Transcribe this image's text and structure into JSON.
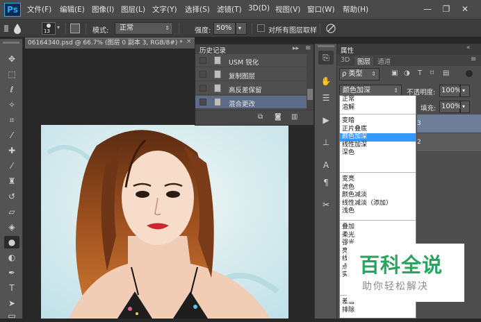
{
  "app": {
    "logo": "Ps"
  },
  "menu": {
    "items": [
      "文件(F)",
      "编辑(E)",
      "图像(I)",
      "图层(L)",
      "文字(Y)",
      "选择(S)",
      "滤镜(T)",
      "3D(D)",
      "视图(V)",
      "窗口(W)",
      "帮助(H)"
    ]
  },
  "window_controls": {
    "minimize": "—",
    "restore": "❐",
    "close": "✕"
  },
  "options_bar": {
    "brush_size": "13",
    "mode_label": "模式:",
    "mode_value": "正常",
    "strength_label": "强度:",
    "strength_value": "50%",
    "sample_all_label": "对所有图层取样"
  },
  "document": {
    "tab_title": "06164340.psd @ 66.7% (图层 0 副本 3, RGB/8#) *",
    "close_icon": "×"
  },
  "history": {
    "title": "历史记录",
    "items": [
      {
        "label": "USM 锐化"
      },
      {
        "label": "复制图层"
      },
      {
        "label": "高反差保留"
      },
      {
        "label": "混合更改"
      }
    ],
    "selected_index": 3
  },
  "layers_panel": {
    "properties_tab": "属性",
    "tabs": [
      "3D",
      "图层",
      "通道"
    ],
    "active_tab": "图层",
    "filter_kind": "ρ 类型",
    "blend_mode": "颜色加深",
    "opacity_label": "不透明度:",
    "opacity_value": "100%",
    "fill_label": "填充:",
    "fill_value": "100%",
    "layer_rows": [
      "3",
      "2"
    ]
  },
  "blend_dropdown": {
    "groups": [
      [
        "正常",
        "溶解"
      ],
      [
        "变暗",
        "正片叠底",
        "颜色加深",
        "线性加深",
        "深色"
      ],
      [
        "变亮",
        "滤色",
        "颜色减淡",
        "线性减淡（添加）",
        "浅色"
      ],
      [
        "叠加",
        "柔光",
        "强光",
        "亮光",
        "线性光",
        "点光",
        "实色混合"
      ],
      [
        "差值",
        "排除"
      ]
    ],
    "selected": "颜色加深"
  },
  "watermark": {
    "title": "百科全说",
    "subtitle": "助你轻松解决"
  },
  "colors": {
    "selection_blue": "#3399ff",
    "panel_dark": "#4d4d4d",
    "watermark_green": "#2ca25f"
  }
}
